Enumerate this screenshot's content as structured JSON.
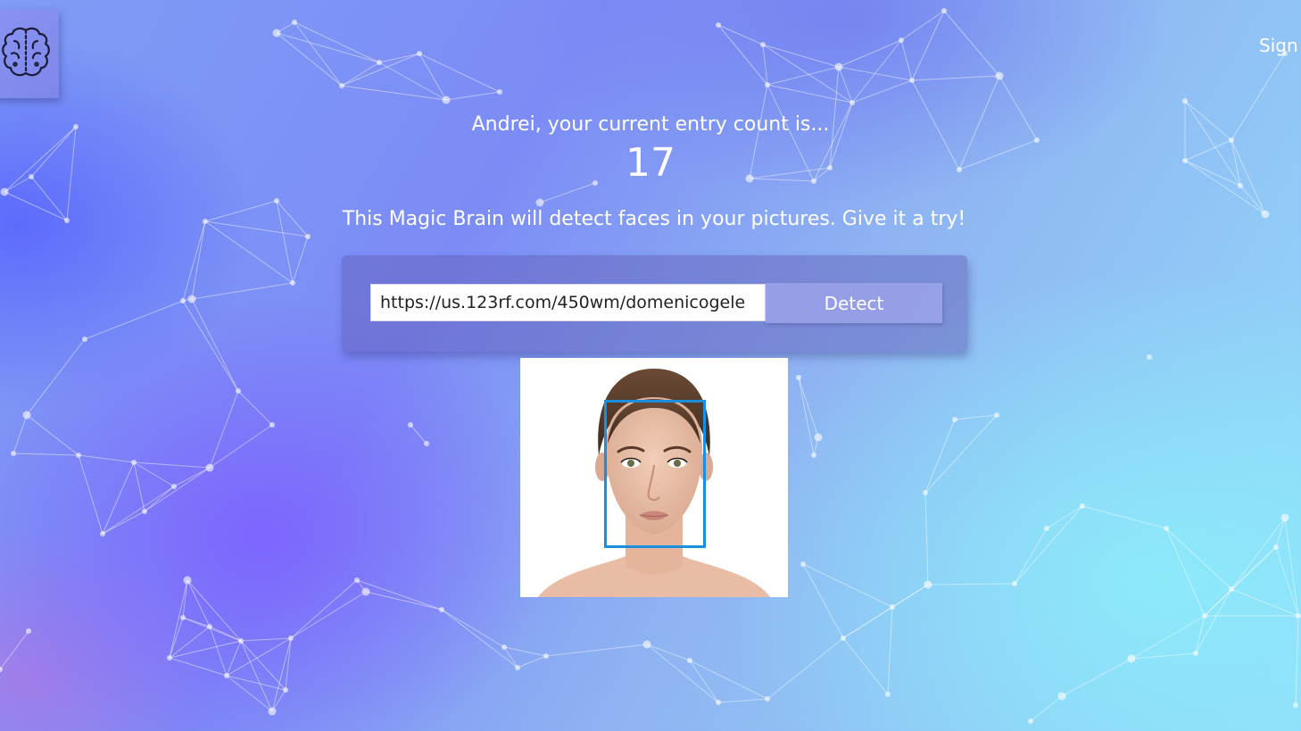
{
  "header": {
    "logo_icon": "brain-icon",
    "signout_label": "Sign"
  },
  "rank": {
    "message": "Andrei, your current entry count is...",
    "count": "17"
  },
  "tagline": "This Magic Brain will detect faces in your pictures. Give it a try!",
  "form": {
    "url_value": "https://us.123rf.com/450wm/domenicogele",
    "button_label": "Detect"
  },
  "result": {
    "image_icon": "face-photo",
    "box_color": "#1a8fe0"
  },
  "colors": {
    "text": "#ffffff",
    "accent": "#1a8fe0"
  }
}
